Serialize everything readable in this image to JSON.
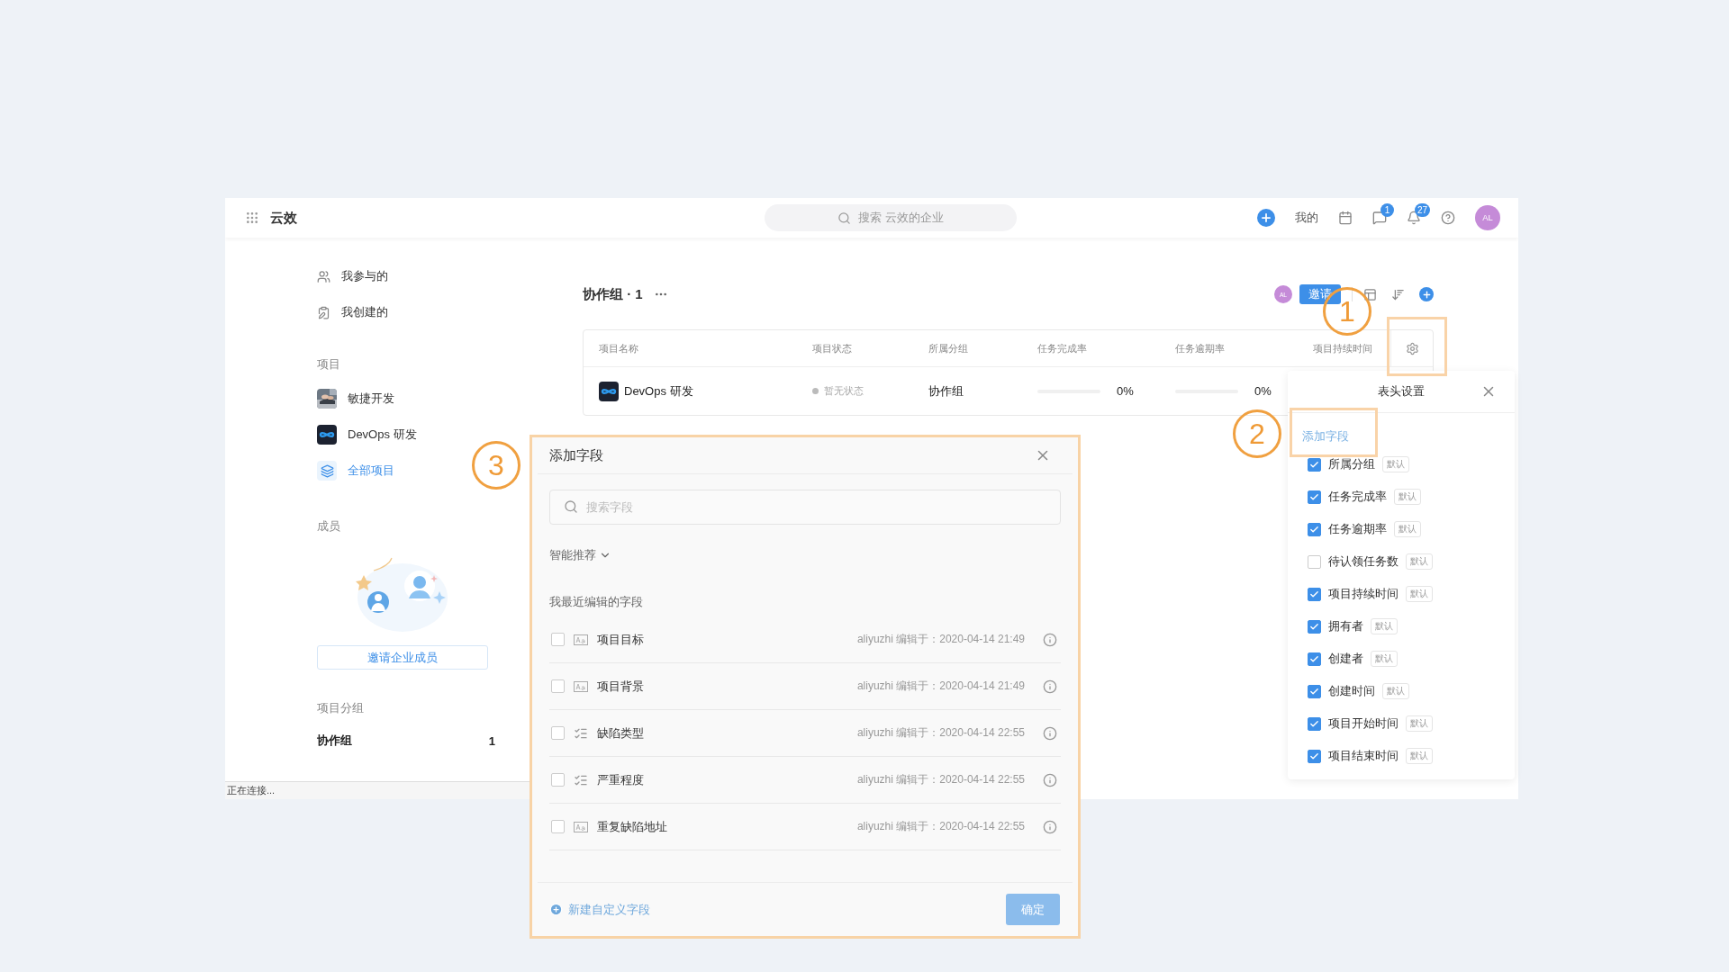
{
  "top_bar": {
    "app_name": "云效",
    "search_placeholder": "搜索 云效的企业",
    "mine": "我的",
    "chat_badge": "1",
    "bell_badge": "27",
    "avatar": "AL"
  },
  "sidebar": {
    "items": [
      {
        "label": "我参与的",
        "kind": "people"
      },
      {
        "label": "我创建的",
        "kind": "clipboard"
      }
    ],
    "project_heading": "项目",
    "projects": [
      {
        "name": "敏捷开发",
        "kind": "picture"
      },
      {
        "name": "DevOps 研发",
        "kind": "devops"
      },
      {
        "name": "全部项目",
        "kind": "all"
      }
    ],
    "members_heading": "成员",
    "invite": "邀请企业成员",
    "group_heading": "项目分组",
    "groups": [
      {
        "name": "协作组",
        "count": "1",
        "selected": true
      }
    ]
  },
  "main": {
    "title": "协作组 · 1",
    "avatar": "AL",
    "invite": "邀请",
    "table": {
      "columns": [
        "项目名称",
        "项目状态",
        "所属分组",
        "任务完成率",
        "任务逾期率",
        "项目持续时间"
      ],
      "rows": [
        {
          "name": "DevOps 研发",
          "status": "暂无状态",
          "group": "协作组",
          "completion": {
            "level": 0,
            "reading": "0%"
          },
          "overdue": {
            "level": 0,
            "reading": "0%"
          }
        }
      ]
    }
  },
  "status_bar": "正在连接...",
  "column_settings": {
    "title": "表头设置",
    "add_field": "添加字段",
    "items": [
      {
        "label": "所属分组",
        "checked": true,
        "tag": "默认"
      },
      {
        "label": "任务完成率",
        "checked": true,
        "tag": "默认"
      },
      {
        "label": "任务逾期率",
        "checked": true,
        "tag": "默认"
      },
      {
        "label": "待认领任务数",
        "checked": false,
        "tag": "默认"
      },
      {
        "label": "项目持续时间",
        "checked": true,
        "tag": "默认"
      },
      {
        "label": "拥有者",
        "checked": true,
        "tag": "默认"
      },
      {
        "label": "创建者",
        "checked": true,
        "tag": "默认"
      },
      {
        "label": "创建时间",
        "checked": true,
        "tag": "默认"
      },
      {
        "label": "项目开始时间",
        "checked": true,
        "tag": "默认"
      },
      {
        "label": "项目结束时间",
        "checked": true,
        "tag": "默认"
      }
    ]
  },
  "add_field_dialog": {
    "title": "添加字段",
    "search_placeholder": "搜索字段",
    "smart": "智能推荐",
    "recent_heading": "我最近编辑的字段",
    "fields": [
      {
        "name": "项目目标",
        "kind": "text",
        "checked": false,
        "meta": "aliyuzhi 编辑于：2020-04-14 21:49"
      },
      {
        "name": "项目背景",
        "kind": "text",
        "checked": false,
        "meta": "aliyuzhi 编辑于：2020-04-14 21:49"
      },
      {
        "name": "缺陷类型",
        "kind": "list",
        "checked": false,
        "meta": "aliyuzhi 编辑于：2020-04-14 22:55"
      },
      {
        "name": "严重程度",
        "kind": "list",
        "checked": false,
        "meta": "aliyuzhi 编辑于：2020-04-14 22:55"
      },
      {
        "name": "重复缺陷地址",
        "kind": "text",
        "checked": false,
        "meta": "aliyuzhi 编辑于：2020-04-14 22:55"
      }
    ],
    "create": "新建自定义字段",
    "confirm": "确定"
  },
  "callouts": [
    "1",
    "2",
    "3"
  ]
}
